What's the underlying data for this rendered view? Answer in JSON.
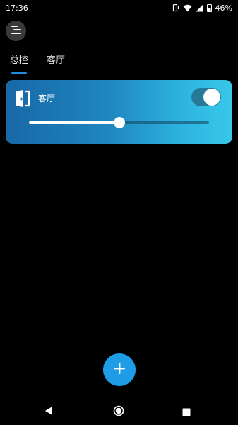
{
  "status_bar": {
    "time": "17:36",
    "battery_percent": "46%",
    "icons": [
      "vibrate-icon",
      "wifi-icon",
      "signal-icon",
      "battery-icon"
    ]
  },
  "menu": {
    "icon": "menu-icon"
  },
  "tabs": [
    {
      "label": "总控",
      "active": true
    },
    {
      "label": "客厅",
      "active": false
    }
  ],
  "room_card": {
    "icon": "door-icon",
    "name": "客厅",
    "power_on": true,
    "brightness": 0.5
  },
  "fab": {
    "icon": "plus-icon"
  },
  "nav": {
    "icons": [
      "back-icon",
      "home-icon",
      "recents-icon"
    ]
  },
  "colors": {
    "accent": "#1e9de6",
    "tab_indicator": "#1d8fe0",
    "card_gradient_start": "#1768a6",
    "card_gradient_end": "#36c8ea"
  }
}
